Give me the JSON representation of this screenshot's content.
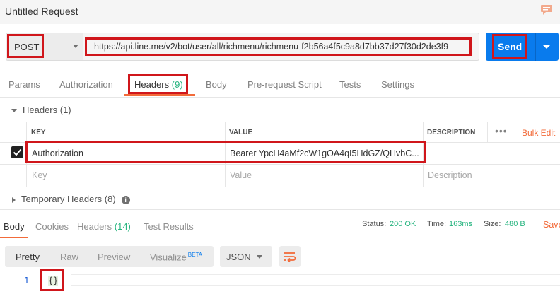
{
  "window": {
    "title": "Untitled Request"
  },
  "request": {
    "method": "POST",
    "url": "https://api.line.me/v2/bot/user/all/richmenu/richmenu-f2b56a4f5c9a8d7bb37d27f30d2de3f9",
    "send_label": "Send"
  },
  "tabs": {
    "params": "Params",
    "authorization": "Authorization",
    "headers": "Headers",
    "headers_count": "(9)",
    "body": "Body",
    "pre_request": "Pre-request Script",
    "tests": "Tests",
    "settings": "Settings"
  },
  "headers_section": {
    "title": "Headers (1)",
    "columns": {
      "key": "KEY",
      "value": "VALUE",
      "description": "DESCRIPTION"
    },
    "bulk_edit": "Bulk Edit",
    "more": "•••",
    "rows": [
      {
        "checked": true,
        "key": "Authorization",
        "value": "Bearer YpcH4aMf2cW1gOA4qI5HdGZ/QHvbC...",
        "description": ""
      }
    ],
    "placeholder": {
      "key": "Key",
      "value": "Value",
      "description": "Description"
    },
    "temporary": "Temporary Headers (8)",
    "info_icon": "i"
  },
  "response": {
    "tabs": {
      "body": "Body",
      "cookies": "Cookies",
      "headers": "Headers",
      "headers_count": "(14)",
      "test_results": "Test Results"
    },
    "status_label": "Status:",
    "status_value": "200 OK",
    "time_label": "Time:",
    "time_value": "163ms",
    "size_label": "Size:",
    "size_value": "480 B",
    "save": "Save",
    "view_modes": {
      "pretty": "Pretty",
      "raw": "Raw",
      "preview": "Preview",
      "visualize": "Visualize",
      "beta": "BETA"
    },
    "format": "JSON",
    "code": {
      "line": "1",
      "content": "{}"
    }
  },
  "colors": {
    "accent": "#f26b3a",
    "primary": "#097bed",
    "success": "#26b47f",
    "highlight": "#d0161b"
  },
  "icons": [
    "comment-icon",
    "chevron-down-icon",
    "checkbox-checked-icon",
    "info-icon",
    "wrap-lines-icon"
  ]
}
